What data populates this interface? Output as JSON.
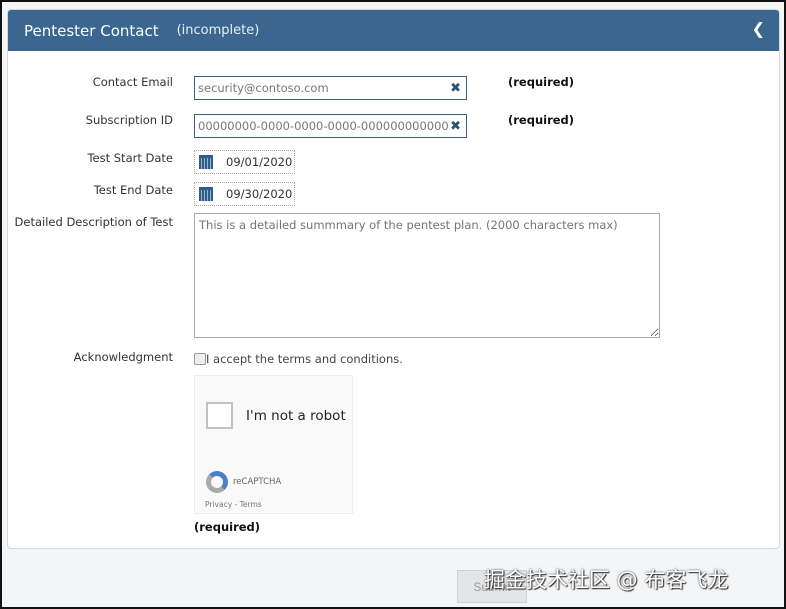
{
  "panel": {
    "title": "Pentester Contact",
    "status": "(incomplete)"
  },
  "fields": {
    "email_label": "Contact Email",
    "email_value": "security@contoso.com",
    "sub_label": "Subscription ID",
    "sub_value": "00000000-0000-0000-0000-000000000000",
    "required": "(required)",
    "start_label": "Test Start Date",
    "start_value": "09/01/2020",
    "end_label": "Test End Date",
    "end_value": "09/30/2020",
    "desc_label": "Detailed Description of Test",
    "desc_placeholder": "This is a detailed summmary of the pentest plan. (2000 characters max)",
    "ack_label": "Acknowledgment",
    "ack_text": "I accept the terms and conditions."
  },
  "captcha": {
    "label": "I'm not a robot",
    "brand": "reCAPTCHA",
    "links": "Privacy - Terms",
    "required": "(required)"
  },
  "submit": "Submit",
  "watermark": "掘金技术社区 @ 布客飞龙"
}
